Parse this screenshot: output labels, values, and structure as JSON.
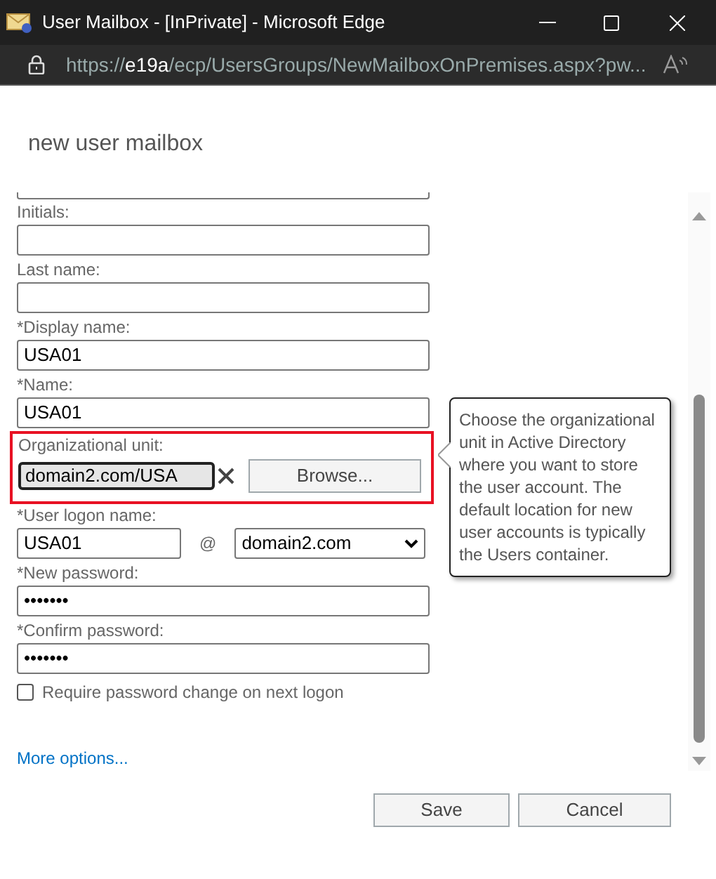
{
  "window": {
    "title": "User Mailbox - [InPrivate] - Microsoft Edge"
  },
  "address_bar": {
    "prefix": "https://",
    "host": "e19a",
    "path": "/ecp/UsersGroups/NewMailboxOnPremises.aspx?pw..."
  },
  "heading": "new user mailbox",
  "fields": [
    {
      "kind": "text",
      "label": "Initials:"
    },
    {
      "kind": "text",
      "label": "Last name:"
    },
    {
      "kind": "text",
      "label": "*Display name:",
      "value": "USA01"
    },
    {
      "kind": "text",
      "label": "*Name:",
      "value": "USA01"
    },
    {
      "kind": "ou",
      "label": "Organizational unit:",
      "value": "domain2.com/USA",
      "button": "Browse...",
      "highlighted": true
    },
    {
      "kind": "logon",
      "label": "*User logon name:",
      "value": "USA01",
      "at": "@",
      "domain": "domain2.com"
    },
    {
      "kind": "password",
      "label": "*New password:",
      "value": "•••••••"
    },
    {
      "kind": "password",
      "label": "*Confirm password:",
      "value": "•••••••"
    },
    {
      "kind": "checkbox",
      "label": "Require password change on next logon",
      "checked": false
    }
  ],
  "tooltip": "Choose the organizational unit in Active Directory where you want to store the user account. The default location for new user accounts is typically the Users container.",
  "more_options": "More options...",
  "buttons": [
    "Save",
    "Cancel"
  ]
}
